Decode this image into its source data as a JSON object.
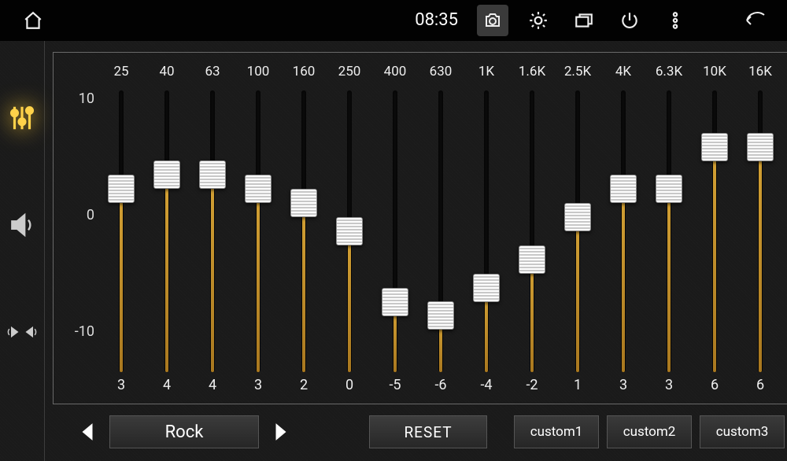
{
  "statusbar": {
    "time": "08:35"
  },
  "axis": {
    "max": "10",
    "mid": "0",
    "min": "-10"
  },
  "eq": {
    "range": {
      "min": -10,
      "max": 10
    },
    "bands": [
      {
        "freq": "25",
        "value": 3
      },
      {
        "freq": "40",
        "value": 4
      },
      {
        "freq": "63",
        "value": 4
      },
      {
        "freq": "100",
        "value": 3
      },
      {
        "freq": "160",
        "value": 2
      },
      {
        "freq": "250",
        "value": 0
      },
      {
        "freq": "400",
        "value": -5
      },
      {
        "freq": "630",
        "value": -6
      },
      {
        "freq": "1K",
        "value": -4
      },
      {
        "freq": "1.6K",
        "value": -2
      },
      {
        "freq": "2.5K",
        "value": 1
      },
      {
        "freq": "4K",
        "value": 3
      },
      {
        "freq": "6.3K",
        "value": 3
      },
      {
        "freq": "10K",
        "value": 6
      },
      {
        "freq": "16K",
        "value": 6
      }
    ]
  },
  "controls": {
    "preset": "Rock",
    "reset": "RESET",
    "custom1": "custom1",
    "custom2": "custom2",
    "custom3": "custom3"
  }
}
